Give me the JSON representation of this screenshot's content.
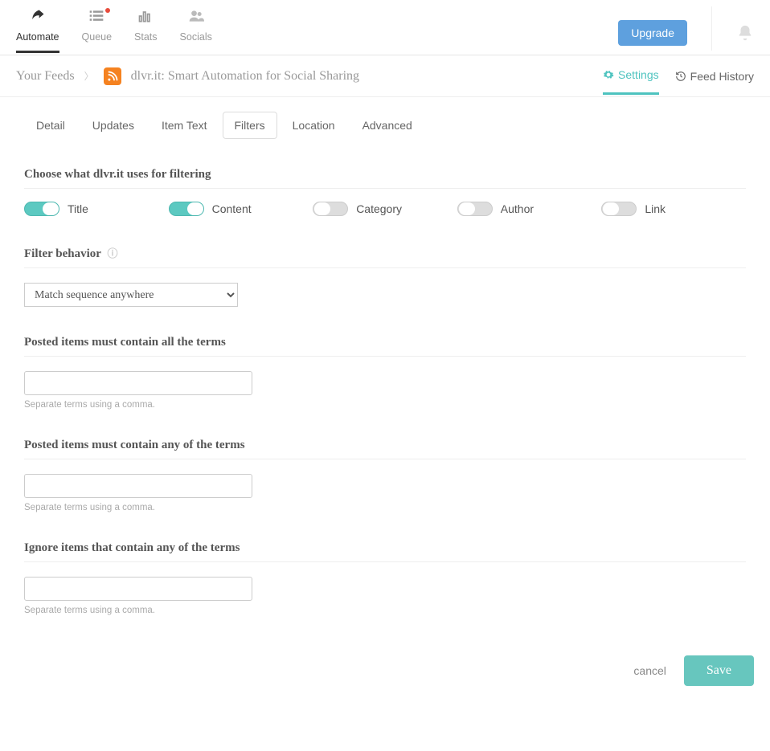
{
  "nav": {
    "automate": "Automate",
    "queue": "Queue",
    "stats": "Stats",
    "socials": "Socials"
  },
  "upgrade": "Upgrade",
  "breadcrumb": {
    "root": "Your Feeds",
    "title": "dlvr.it: Smart Automation for Social Sharing"
  },
  "crumb_links": {
    "settings": "Settings",
    "history": "Feed History"
  },
  "tabs": {
    "detail": "Detail",
    "updates": "Updates",
    "itemtext": "Item Text",
    "filters": "Filters",
    "location": "Location",
    "advanced": "Advanced"
  },
  "sections": {
    "choose": "Choose what dlvr.it uses for filtering",
    "behavior": "Filter behavior",
    "must_all": "Posted items must contain all the terms",
    "must_any": "Posted items must contain any of the terms",
    "ignore_any": "Ignore items that contain any of the terms"
  },
  "toggles": {
    "title": "Title",
    "content": "Content",
    "category": "Category",
    "author": "Author",
    "link": "Link"
  },
  "select": {
    "value": "Match sequence anywhere"
  },
  "helper": "Separate terms using a comma.",
  "footer": {
    "cancel": "cancel",
    "save": "Save"
  }
}
